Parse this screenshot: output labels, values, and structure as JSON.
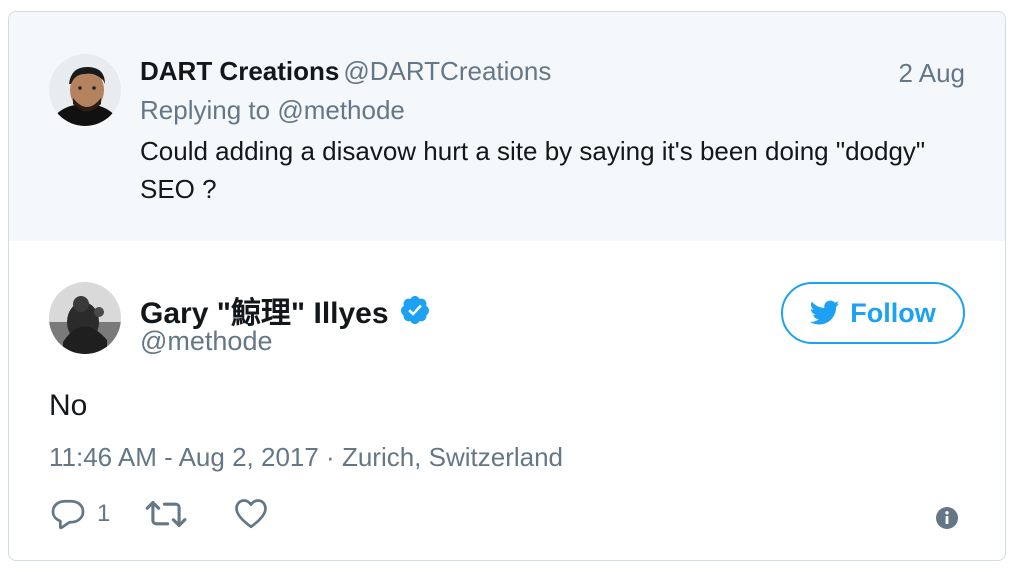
{
  "parent_tweet": {
    "author_name": "DART Creations",
    "author_handle": "@DARTCreations",
    "date": "2 Aug",
    "replying_label": "Replying to",
    "replying_handle": "@methode",
    "text": "Could adding a disavow hurt a site by saying it's been doing \"dodgy\" SEO ?"
  },
  "main_tweet": {
    "author_name": "Gary \"鯨理\" Illyes",
    "author_handle": "@methode",
    "verified": true,
    "follow_label": "Follow",
    "text": "No",
    "timestamp": "11:46 AM - Aug 2, 2017",
    "separator": " · ",
    "location": "Zurich, Switzerland",
    "reply_count": "1"
  },
  "icons": {
    "verified": "verified-badge-icon",
    "follow": "twitter-bird-icon",
    "reply": "reply-bubble-icon",
    "retweet": "retweet-icon",
    "like": "heart-icon",
    "info": "info-icon"
  },
  "colors": {
    "accent": "#1da1f2",
    "text_primary": "#14171a",
    "text_secondary": "#657786",
    "parent_background": "#f5f8fa",
    "border": "#d3dbe3"
  }
}
